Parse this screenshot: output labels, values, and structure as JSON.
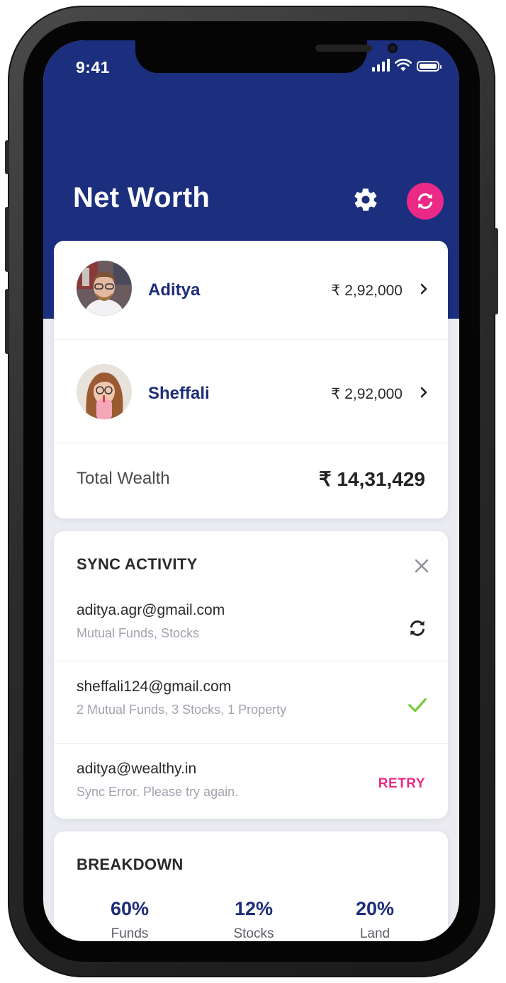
{
  "status_bar": {
    "time": "9:41"
  },
  "header": {
    "title": "Net Worth"
  },
  "members": [
    {
      "name": "Aditya",
      "amount": "₹ 2,92,000"
    },
    {
      "name": "Sheffali",
      "amount": "₹ 2,92,000"
    }
  ],
  "total": {
    "label": "Total Wealth",
    "value": "₹ 14,31,429"
  },
  "sync_activity": {
    "title": "SYNC ACTIVITY",
    "accounts": [
      {
        "email": "aditya.agr@gmail.com",
        "detail": "Mutual Funds, Stocks",
        "status": "syncing"
      },
      {
        "email": "sheffali124@gmail.com",
        "detail": "2 Mutual Funds, 3 Stocks, 1 Property",
        "status": "done"
      },
      {
        "email": "aditya@wealthy.in",
        "detail": "Sync Error. Please try again.",
        "status": "error",
        "action": "RETRY"
      }
    ]
  },
  "breakdown": {
    "title": "BREAKDOWN",
    "items": [
      {
        "percent": "60%",
        "label": "Funds"
      },
      {
        "percent": "12%",
        "label": "Stocks"
      },
      {
        "percent": "20%",
        "label": "Land"
      }
    ]
  },
  "colors": {
    "primary": "#1b2f7e",
    "accent": "#ea2a86",
    "success": "#7ac943",
    "background": "#ebecf1"
  },
  "icons": [
    "settings-gear-icon",
    "sync-icon",
    "chevron-right-icon",
    "close-icon",
    "check-icon",
    "wifi-icon",
    "signal-icon",
    "battery-icon"
  ]
}
